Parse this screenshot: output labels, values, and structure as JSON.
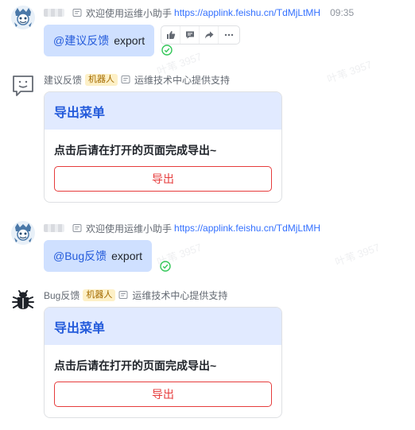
{
  "messages": [
    {
      "meta": {
        "text": "欢迎使用运维小助手",
        "link": "https://applink.feishu.cn/TdMjLtMH",
        "time": "09:35"
      },
      "bubble": {
        "mention": "@建议反馈",
        "text": "export"
      }
    },
    {
      "meta": {
        "name": "建议反馈",
        "tag": "机器人",
        "text": "运维技术中心提供支持"
      },
      "card": {
        "title": "导出菜单",
        "text": "点击后请在打开的页面完成导出~",
        "button": "导出"
      }
    },
    {
      "meta": {
        "text": "欢迎使用运维小助手",
        "link": "https://applink.feishu.cn/TdMjLtMH"
      },
      "bubble": {
        "mention": "@Bug反馈",
        "text": "export"
      }
    },
    {
      "meta": {
        "name": "Bug反馈",
        "tag": "机器人",
        "text": "运维技术中心提供支持"
      },
      "card": {
        "title": "导出菜单",
        "text": "点击后请在打开的页面完成导出~",
        "button": "导出"
      }
    }
  ],
  "reaction_icons": [
    "thumbs-up-icon",
    "comment-icon",
    "forward-icon",
    "more-icon"
  ],
  "watermark": "叶苇 3957",
  "colors": {
    "accent": "#245bdb",
    "bubble": "#cfe0ff",
    "card_header": "#e1eaff",
    "danger": "#e63c3c",
    "read_check": "#34c759",
    "bot_tag_bg": "#fdf0c7"
  }
}
